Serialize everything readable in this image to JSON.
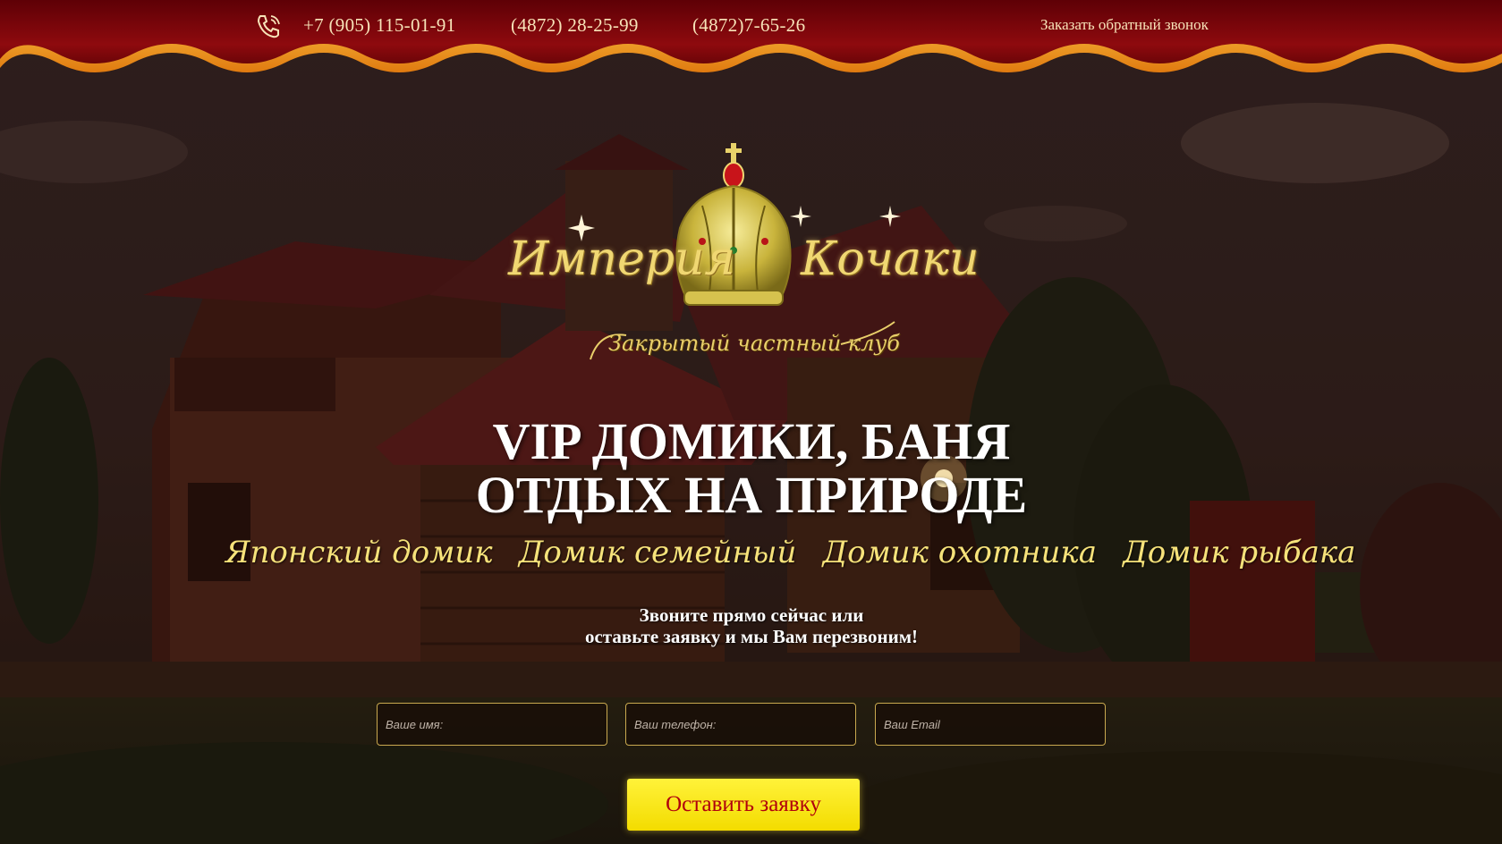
{
  "header": {
    "phones": [
      "+7 (905) 115-01-91",
      "(4872) 28-25-99",
      "(4872)7-65-26"
    ],
    "callback_label": "Заказать обратный звонок"
  },
  "logo": {
    "word_left": "Империя",
    "word_right": "Кочаки",
    "subtitle": "Закрытый частный клуб"
  },
  "hero": {
    "title_line1": "VIP ДОМИКИ, БАНЯ",
    "title_line2": "ОТДЫХ НА ПРИРОДЕ",
    "houses": [
      "Японский домик",
      "Домик семейный",
      "Домик охотника",
      "Домик рыбака"
    ],
    "cta_line1": "Звоните прямо сейчас или",
    "cta_line2": "оставьте заявку и мы Вам перезвоним!"
  },
  "form": {
    "name_placeholder": "Ваше имя:",
    "phone_placeholder": "Ваш телефон:",
    "email_placeholder": "Ваш Email",
    "submit_label": "Оставить заявку"
  },
  "colors": {
    "header_red": "#7a0008",
    "fringe_orange": "#f5a623",
    "gold_text": "#f6e27a",
    "button_yellow": "#fff23a",
    "button_text": "#b0000d"
  }
}
